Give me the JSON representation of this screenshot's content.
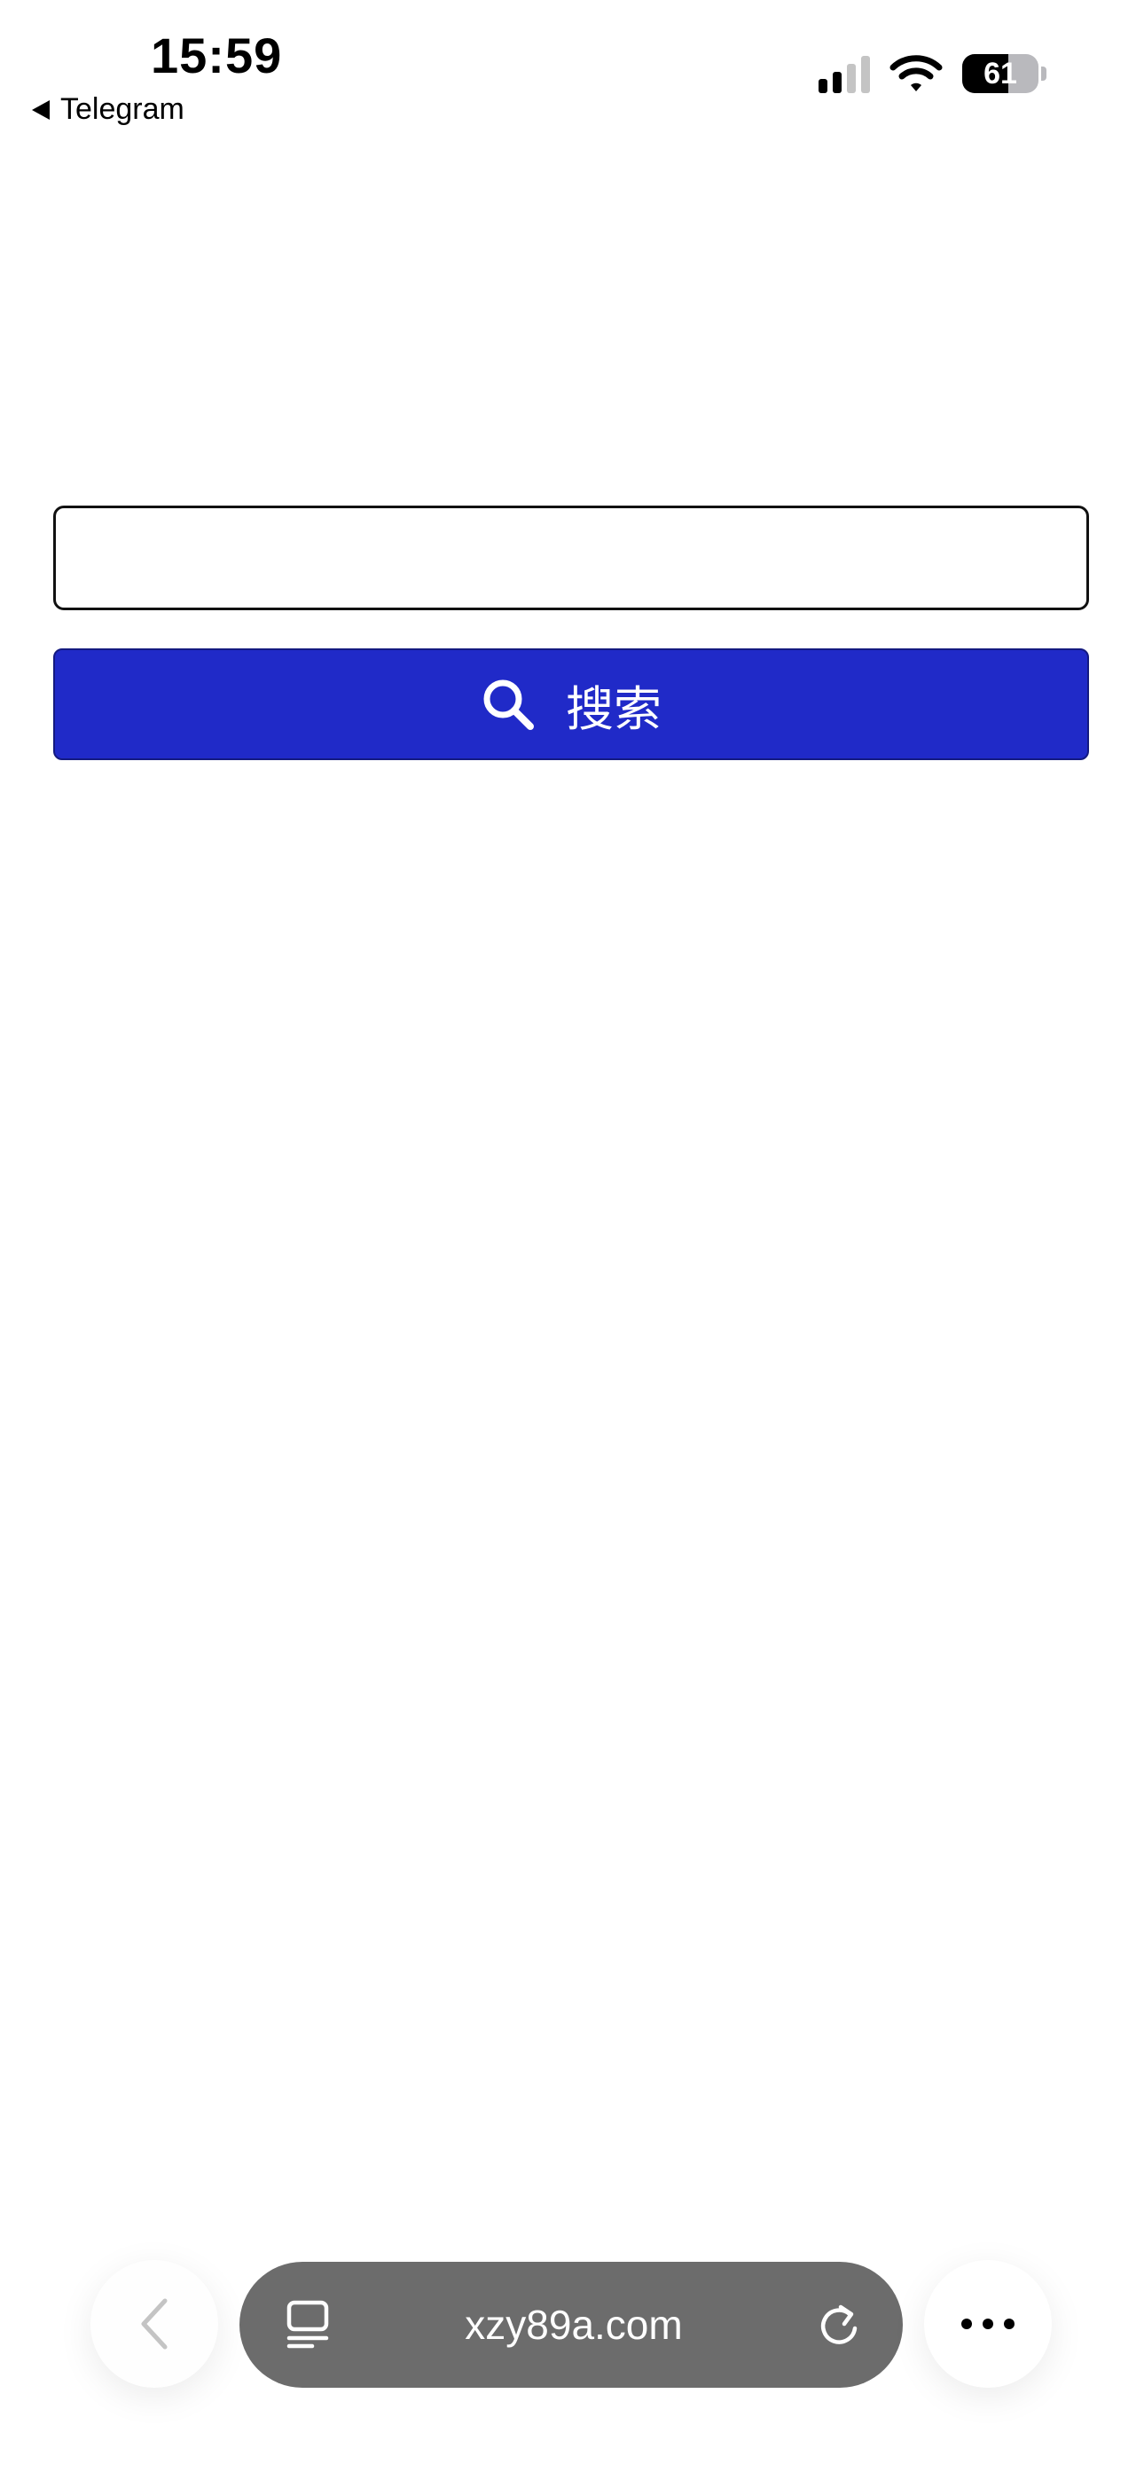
{
  "status_bar": {
    "time": "15:59",
    "back_app_label": "Telegram",
    "battery_level": 61,
    "battery_text": "61",
    "signal_bars_active": 2,
    "signal_bars_total": 4
  },
  "search": {
    "input_value": "",
    "button_label": "搜索",
    "button_color": "#202ac8",
    "button_icon": "search-icon"
  },
  "browser_toolbar": {
    "url": "xzy89a.com",
    "back_icon": "chevron-left-icon",
    "tabs_icon": "tab-overview-icon",
    "reload_icon": "reload-icon",
    "more_icon": "ellipsis-icon",
    "url_bar_color": "#6c6c6c"
  }
}
